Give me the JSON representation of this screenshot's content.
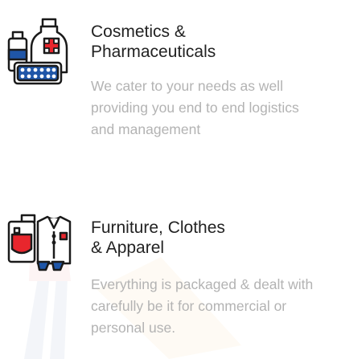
{
  "services": [
    {
      "icon": "cosmetics-pharma-icon",
      "title_line1": "Cosmetics &",
      "title_line2": "Pharmaceuticals",
      "desc_line1": "We cater to your needs as well",
      "desc_line2": "providing you end to end logistics",
      "desc_line3": "and management"
    },
    {
      "icon": "furniture-clothes-icon",
      "title_line1": "Furniture, Clothes",
      "title_line2": "& Apparel",
      "desc_line1": "Everything is packaged & dealt with",
      "desc_line2": "carefully be it for commercial or",
      "desc_line3": "personal use."
    }
  ],
  "colors": {
    "title": "#222222",
    "description": "#b3b3b3",
    "icon_outline": "#1a1a1a",
    "icon_red": "#e8262d",
    "icon_blue": "#1f56a8"
  }
}
